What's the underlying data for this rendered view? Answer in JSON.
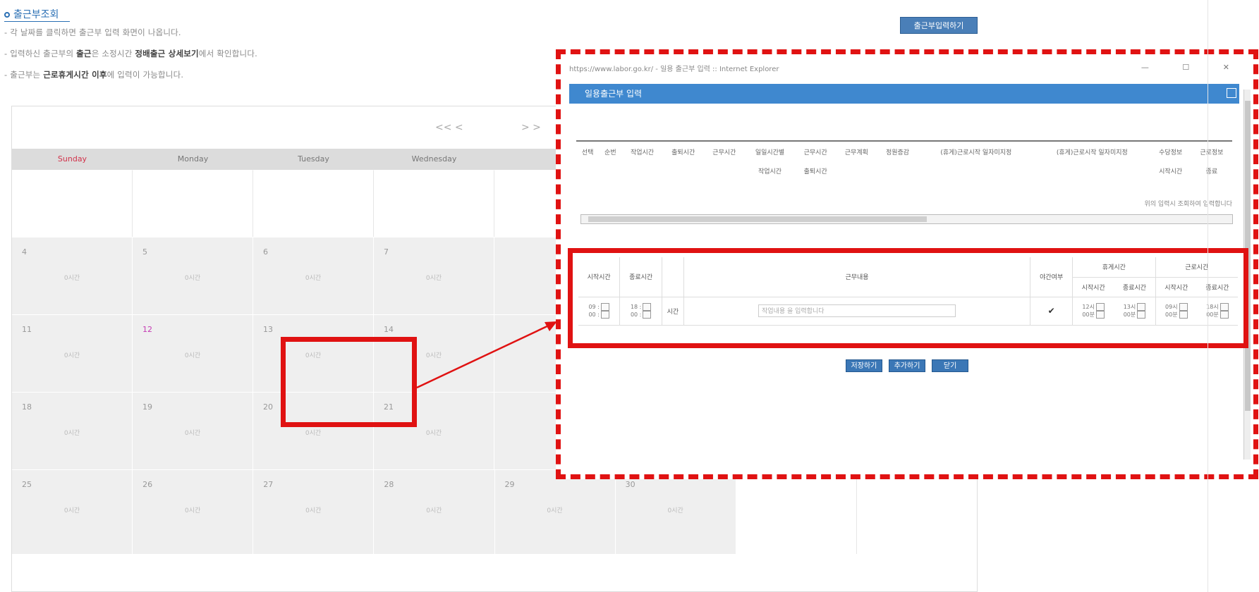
{
  "page_title": "출근부조회",
  "notices": [
    {
      "text": "- 각 날짜를 클릭하면 출근부 입력 화면이 나옵니다."
    },
    {
      "pre": "- 입력하신 출근부의 ",
      "bold1": "출근",
      "mid": "은 소정시간 ",
      "bold2": "정배출근 상세보기",
      "post": "에서 확인합니다."
    },
    {
      "pre": "- 출근부는 ",
      "bold1": "근로휴게시간 이후",
      "post": "에 입력이 가능합니다."
    }
  ],
  "top_button": "출근부입력하기",
  "calendar": {
    "nav_prev": "<< <",
    "nav_next": "> >",
    "weekdays": [
      "Sunday",
      "Monday",
      "Tuesday",
      "Wednesday",
      "",
      "",
      "",
      ""
    ],
    "weeks": [
      [
        {
          "d": ""
        },
        {
          "d": ""
        },
        {
          "d": ""
        },
        {
          "d": ""
        }
      ],
      [
        {
          "d": "4",
          "c": "0시간"
        },
        {
          "d": "5",
          "c": "0시간"
        },
        {
          "d": "6",
          "c": "0시간"
        },
        {
          "d": "7",
          "c": "0시간"
        }
      ],
      [
        {
          "d": "11",
          "c": "0시간"
        },
        {
          "d": "12",
          "c": "0시간",
          "holiday": true
        },
        {
          "d": "13",
          "c": "0시간"
        },
        {
          "d": "14",
          "c": "0시간"
        }
      ],
      [
        {
          "d": "18",
          "c": "0시간"
        },
        {
          "d": "19",
          "c": "0시간"
        },
        {
          "d": "20",
          "c": "0시간"
        },
        {
          "d": "21",
          "c": "0시간"
        }
      ],
      [
        {
          "d": "25",
          "c": "0시간"
        },
        {
          "d": "26",
          "c": "0시간"
        },
        {
          "d": "27",
          "c": "0시간"
        },
        {
          "d": "28",
          "c": "0시간"
        },
        {
          "d": "29",
          "c": "0시간"
        },
        {
          "d": "30",
          "c": "0시간"
        }
      ]
    ]
  },
  "popup": {
    "titlebar": "https://www.labor.go.kr/ - 일용 출근부 입력 :: Internet Explorer",
    "window_controls": "— ☐ ✕",
    "header": "일용출근부 입력",
    "grid1": {
      "row1": [
        "선택",
        "순번",
        "작업시간",
        "출퇴시간",
        "근무시간",
        "일일시간별",
        "근무시간",
        "근무계획",
        "정원증감",
        "(휴게)근로시작 일자미지정",
        "(휴게)근로시작 일자미지정",
        "수당정보",
        "근로정보"
      ],
      "sub": [
        "작업시간",
        "출퇴시간",
        "시작시간",
        "종료"
      ],
      "note": "위의 입력시 조회하여 입력합니다"
    },
    "grid2": {
      "headers": [
        "시작시간",
        "종료시간",
        "",
        "근무내용",
        "야간여부",
        "휴게시간",
        "",
        "근로시간",
        ""
      ],
      "sub": [
        "시작시간",
        "종료시간",
        "시작시간",
        "종료시간"
      ],
      "row": {
        "start": [
          "09 :",
          "00 :"
        ],
        "end": [
          "18 :",
          "00 :"
        ],
        "label": "시간",
        "content": "작업내용 을 입력합니다",
        "check": "✔",
        "breakStart": [
          "12시",
          "00분"
        ],
        "breakEnd": [
          "13시",
          "00분"
        ],
        "workStart": [
          "09시",
          "00분"
        ],
        "workEnd": [
          "18시",
          "00분"
        ]
      }
    },
    "buttons": [
      "저장하기",
      "추가하기",
      "닫기"
    ]
  }
}
